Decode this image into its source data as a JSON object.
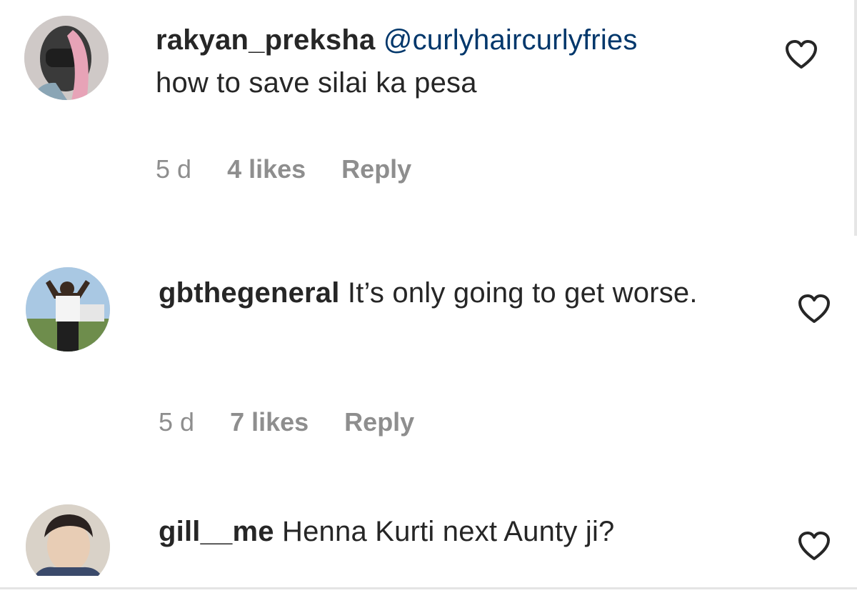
{
  "comments": [
    {
      "username": "rakyan_preksha",
      "mention": "@curlyhaircurlyfries",
      "text": "how to save silai ka pesa",
      "time": "5 d",
      "likes": "4 likes",
      "reply": "Reply",
      "avatar_colors": [
        "#3a3a3a",
        "#e2a0b4",
        "#f2c6d1"
      ]
    },
    {
      "username": "gbthegeneral",
      "mention": "",
      "text": "It’s only going to get worse.",
      "time": "5 d",
      "likes": "7 likes",
      "reply": "Reply",
      "avatar_colors": [
        "#9fc3e0",
        "#2d2d2d",
        "#6e8d4c"
      ]
    },
    {
      "username": "gill__me",
      "mention": "",
      "text": "Henna Kurti next Aunty ji?",
      "avatar_colors": [
        "#c6b6a3",
        "#3b4a6b",
        "#e8d8c4"
      ]
    }
  ],
  "icons": {
    "heart": "heart-outline-icon"
  },
  "colors": {
    "text": "#262626",
    "meta": "#8e8e8e",
    "mention": "#00376b"
  }
}
